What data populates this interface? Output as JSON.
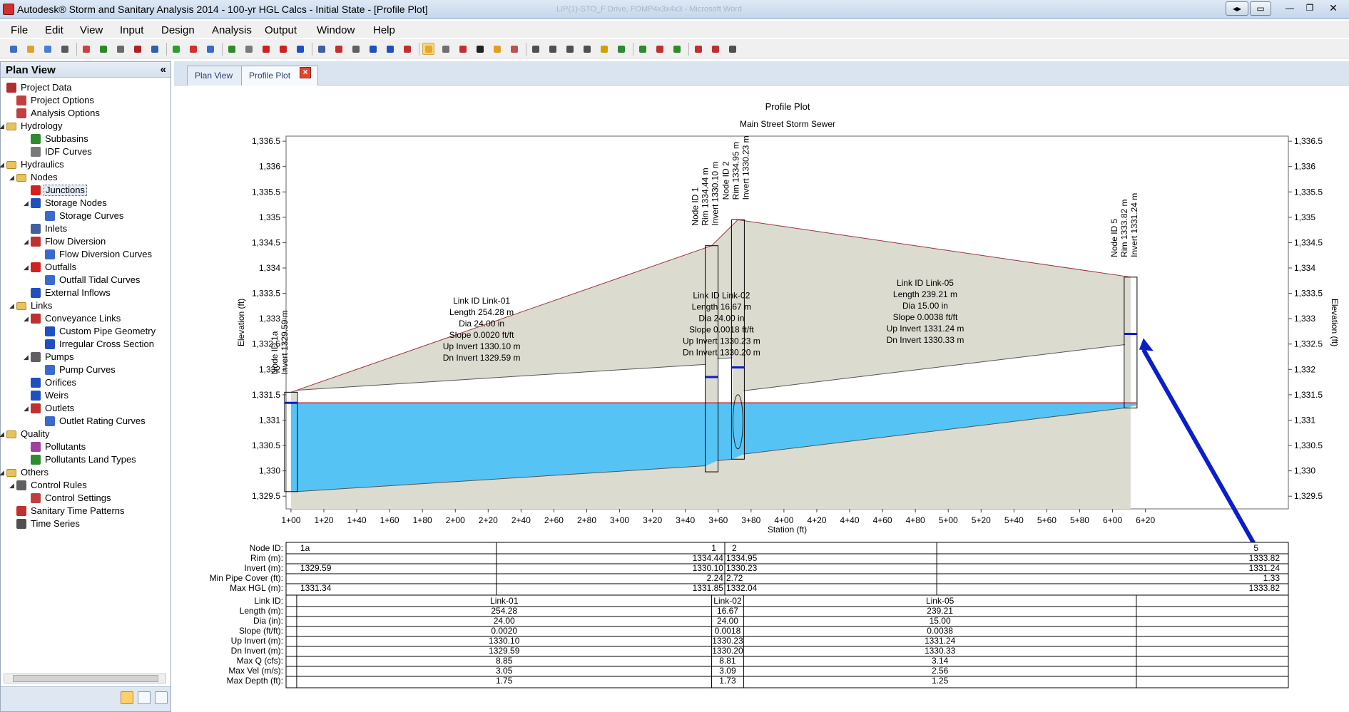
{
  "window": {
    "title": "Autodesk® Storm and Sanitary Analysis 2014 - 100-yr HGL Calcs - Initial State - [Profile Plot]",
    "background_title": "LIP(1)-STO_F Drive, FOMP4x3x4x3 - Microsoft Word"
  },
  "menu": [
    "File",
    "Edit",
    "View",
    "Input",
    "Design",
    "Analysis",
    "Output",
    "Window",
    "Help"
  ],
  "toolbar_icons": [
    "new-icon",
    "open-icon",
    "save-icon",
    "print-icon",
    "calculator-icon",
    "pan-icon",
    "copy-icon",
    "delete-icon",
    "find-icon",
    "add-node-icon",
    "run-icon",
    "help-icon",
    "subbasin-icon",
    "idf-icon",
    "junction-icon",
    "outfall-icon",
    "storage-icon",
    "inlet-icon",
    "pipe-icon",
    "pump-icon",
    "orifice-icon",
    "weir-icon",
    "outlet-icon",
    "select-icon",
    "tools-icon",
    "polygon-icon",
    "text-icon",
    "pencil-icon",
    "measure-icon",
    "zoom-icon",
    "zoom-out-icon",
    "zoom-window-icon",
    "pan-hand-icon",
    "lock-icon",
    "play-icon",
    "step-icon",
    "report-icon",
    "excel-icon",
    "pdf-icon",
    "profile-icon",
    "options-icon"
  ],
  "sidebar": {
    "title": "Plan View",
    "collapse": "«",
    "items": [
      {
        "label": "Project Data",
        "level": 0,
        "toggle": "",
        "icon": "project-data-icon",
        "color": "#b03030"
      },
      {
        "label": "Project Options",
        "level": 1,
        "toggle": "",
        "icon": "checklist-icon",
        "color": "#c04040"
      },
      {
        "label": "Analysis Options",
        "level": 1,
        "toggle": "",
        "icon": "tools-icon",
        "color": "#c04040"
      },
      {
        "label": "Hydrology",
        "level": 0,
        "toggle": "◢",
        "icon": "folder-icon",
        "color": "#e8c35a"
      },
      {
        "label": "Subbasins",
        "level": 2,
        "toggle": "",
        "icon": "subbasin-icon",
        "color": "#2e8b2e"
      },
      {
        "label": "IDF Curves",
        "level": 2,
        "toggle": "",
        "icon": "idf-curve-icon",
        "color": "#7a7a7a"
      },
      {
        "label": "Hydraulics",
        "level": 0,
        "toggle": "◢",
        "icon": "folder-icon",
        "color": "#e8c35a"
      },
      {
        "label": "Nodes",
        "level": 1,
        "toggle": "◢",
        "icon": "folder-icon",
        "color": "#e8c35a"
      },
      {
        "label": "Junctions",
        "level": 2,
        "toggle": "",
        "icon": "junction-icon",
        "color": "#d22020",
        "selected": true
      },
      {
        "label": "Storage Nodes",
        "level": 2,
        "toggle": "◢",
        "icon": "storage-icon",
        "color": "#2050c0"
      },
      {
        "label": "Storage Curves",
        "level": 3,
        "toggle": "",
        "icon": "curve-icon",
        "color": "#3a6ad0"
      },
      {
        "label": "Inlets",
        "level": 2,
        "toggle": "",
        "icon": "inlet-icon",
        "color": "#4060a0"
      },
      {
        "label": "Flow Diversion",
        "level": 2,
        "toggle": "◢",
        "icon": "flow-diversion-icon",
        "color": "#c03030"
      },
      {
        "label": "Flow Diversion Curves",
        "level": 3,
        "toggle": "",
        "icon": "curve-icon",
        "color": "#3a6ad0"
      },
      {
        "label": "Outfalls",
        "level": 2,
        "toggle": "◢",
        "icon": "outfall-icon",
        "color": "#d02020"
      },
      {
        "label": "Outfall Tidal Curves",
        "level": 3,
        "toggle": "",
        "icon": "curve-icon",
        "color": "#3a6ad0"
      },
      {
        "label": "External Inflows",
        "level": 2,
        "toggle": "",
        "icon": "inflow-icon",
        "color": "#2050c0"
      },
      {
        "label": "Links",
        "level": 1,
        "toggle": "◢",
        "icon": "folder-icon",
        "color": "#e8c35a"
      },
      {
        "label": "Conveyance Links",
        "level": 2,
        "toggle": "◢",
        "icon": "conveyance-link-icon",
        "color": "#c03030"
      },
      {
        "label": "Custom Pipe Geometry",
        "level": 3,
        "toggle": "",
        "icon": "pipe-geometry-icon",
        "color": "#2050c0"
      },
      {
        "label": "Irregular Cross Section",
        "level": 3,
        "toggle": "",
        "icon": "cross-section-icon",
        "color": "#2050c0"
      },
      {
        "label": "Pumps",
        "level": 2,
        "toggle": "◢",
        "icon": "pump-icon",
        "color": "#606060"
      },
      {
        "label": "Pump Curves",
        "level": 3,
        "toggle": "",
        "icon": "curve-icon",
        "color": "#3a6ad0"
      },
      {
        "label": "Orifices",
        "level": 2,
        "toggle": "",
        "icon": "orifice-icon",
        "color": "#2050c0"
      },
      {
        "label": "Weirs",
        "level": 2,
        "toggle": "",
        "icon": "weir-icon",
        "color": "#2050c0"
      },
      {
        "label": "Outlets",
        "level": 2,
        "toggle": "◢",
        "icon": "outlet-icon",
        "color": "#c03030"
      },
      {
        "label": "Outlet Rating Curves",
        "level": 3,
        "toggle": "",
        "icon": "curve-icon",
        "color": "#3a6ad0"
      },
      {
        "label": "Quality",
        "level": 0,
        "toggle": "◢",
        "icon": "folder-icon",
        "color": "#e8c35a"
      },
      {
        "label": "Pollutants",
        "level": 2,
        "toggle": "",
        "icon": "pollutant-icon",
        "color": "#a040a0"
      },
      {
        "label": "Pollutants Land Types",
        "level": 2,
        "toggle": "",
        "icon": "land-type-icon",
        "color": "#2e8b2e"
      },
      {
        "label": "Others",
        "level": 0,
        "toggle": "◢",
        "icon": "folder-icon",
        "color": "#e8c35a"
      },
      {
        "label": "Control Rules",
        "level": 1,
        "toggle": "◢",
        "icon": "control-rules-icon",
        "color": "#606060"
      },
      {
        "label": "Control Settings",
        "level": 2,
        "toggle": "",
        "icon": "control-settings-icon",
        "color": "#c04040"
      },
      {
        "label": "Sanitary Time Patterns",
        "level": 1,
        "toggle": "",
        "icon": "time-pattern-icon",
        "color": "#c03030"
      },
      {
        "label": "Time Series",
        "level": 1,
        "toggle": "",
        "icon": "clock-icon",
        "color": "#505050"
      }
    ]
  },
  "tabs": [
    {
      "label": "Plan View",
      "active": false
    },
    {
      "label": "Profile Plot",
      "active": true
    }
  ],
  "chart_data": {
    "type": "profile",
    "title": "Profile Plot",
    "subtitle": "Main Street Storm Sewer",
    "xlabel": "Station (ft)",
    "ylabel": "Elevation (ft)",
    "ylabel_right": "Elevation (ft)",
    "xlim": [
      -3,
      607
    ],
    "ylim": [
      1329.25,
      1336.6
    ],
    "x_ticks": [
      0,
      20,
      40,
      60,
      80,
      100,
      120,
      140,
      160,
      180,
      200,
      220,
      240,
      260,
      280,
      300,
      320,
      340,
      360,
      380,
      400,
      420,
      440,
      460,
      480,
      500,
      520,
      540,
      560,
      580,
      600
    ],
    "x_tick_labels": [
      "1+00",
      "1+20",
      "1+40",
      "1+60",
      "1+80",
      "2+00",
      "2+20",
      "2+40",
      "2+60",
      "2+80",
      "3+00",
      "3+20",
      "3+40",
      "3+60",
      "3+80",
      "4+00",
      "4+20",
      "4+40",
      "4+60",
      "4+80",
      "5+00",
      "5+20",
      "5+40",
      "5+60",
      "5+80",
      "6+00",
      "6+20"
    ],
    "y_ticks": [
      1329.5,
      1330,
      1330.5,
      1331,
      1331.5,
      1332,
      1332.5,
      1333,
      1333.5,
      1334,
      1334.5,
      1335,
      1335.5,
      1336,
      1336.5
    ],
    "y_tick_labels": [
      "1,329.5",
      "1,330",
      "1,330.5",
      "1,331",
      "1,331.5",
      "1,332",
      "1,332.5",
      "1,333",
      "1,333.5",
      "1,334",
      "1,334.5",
      "1,335",
      "1,335.5",
      "1,336",
      "1,336.5"
    ],
    "hgl_elevation": 1331.34,
    "nodes": [
      {
        "id": "1a",
        "station": 0,
        "rim": 1331.55,
        "invert": 1329.59,
        "bottom": 1329.59,
        "hgl": 1331.34,
        "labels": [
          "Node ID 1a",
          "Invert 1329.59 m"
        ]
      },
      {
        "id": "1",
        "station": 256,
        "rim": 1334.44,
        "invert": 1330.1,
        "bottom": 1329.98,
        "hgl": 1331.85,
        "labels": [
          "Node ID 1",
          "Rim 1334.44 m",
          "Invert 1330.10 m"
        ]
      },
      {
        "id": "2",
        "station": 272,
        "rim": 1334.95,
        "invert": 1330.23,
        "bottom": 1330.23,
        "hgl": 1332.04,
        "labels": [
          "Node ID 2",
          "Rim 1334.95 m",
          "Invert 1330.23 m"
        ]
      },
      {
        "id": "5",
        "station": 511,
        "rim": 1333.82,
        "invert": 1331.24,
        "bottom": 1331.24,
        "hgl": 1332.7,
        "labels": [
          "Node ID 5",
          "Rim 1333.82 m",
          "Invert 1331.24 m"
        ]
      }
    ],
    "links": [
      {
        "id": "Link-01",
        "from": "1a",
        "to": "1",
        "up_crown": 1332.1,
        "dn_crown": 1331.59,
        "up_invert": 1330.1,
        "dn_invert": 1329.59,
        "labels": [
          "Link ID Link-01",
          "Length 254.28 m",
          "Dia 24.00 in",
          "Slope 0.0020 ft/ft",
          "Up Invert 1330.10 m",
          "Dn Invert 1329.59 m"
        ],
        "label_station": 116,
        "label_elevation": 1333.3
      },
      {
        "id": "Link-02",
        "from": "1",
        "to": "2",
        "up_crown": 1332.23,
        "dn_crown": 1332.21,
        "up_invert": 1330.23,
        "dn_invert": 1330.2,
        "labels": [
          "Link ID Link-02",
          "Length 16.67 m",
          "Dia 24.00 in",
          "Slope 0.0018 ft/ft",
          "Up Invert 1330.23 m",
          "Dn Invert 1330.20 m"
        ],
        "label_station": 262,
        "label_elevation": 1333.4
      },
      {
        "id": "Link-05",
        "from": "2",
        "to": "5",
        "up_crown": 1332.49,
        "dn_crown": 1331.58,
        "up_invert": 1331.24,
        "dn_invert": 1330.33,
        "labels": [
          "Link ID Link-05",
          "Length 239.21 m",
          "Dia 15.00 in",
          "Slope 0.0038 ft/ft",
          "Up Invert 1331.24 m",
          "Dn Invert 1330.33 m"
        ],
        "label_station": 386,
        "label_elevation": 1333.65
      }
    ],
    "node_table": {
      "headers": [
        "Node ID:",
        "Rim (m):",
        "Invert (m):",
        "Min Pipe Cover (ft):",
        "Max HGL (m):"
      ],
      "columns": [
        {
          "node": "1a",
          "values": [
            "1a",
            "",
            "1329.59",
            "",
            "1331.34"
          ],
          "align": "left"
        },
        {
          "node": "1",
          "values": [
            "1",
            "1334.44",
            "1330.10",
            "2.24",
            "1331.85"
          ],
          "align": "right"
        },
        {
          "node": "2",
          "values": [
            "2",
            "1334.95",
            "1330.23",
            "2.72",
            "1332.04"
          ],
          "align": "left"
        },
        {
          "node": "5",
          "values": [
            "5",
            "1333.82",
            "1331.24",
            "1.33",
            "1333.82"
          ],
          "align": "right"
        }
      ]
    },
    "link_table": {
      "headers": [
        "Link ID:",
        "Length (m):",
        "Dia (in):",
        "Slope (ft/ft):",
        "Up Invert (m):",
        "Dn Invert (m):",
        "Max Q (cfs):",
        "Max Vel (m/s):",
        "Max Depth (ft):"
      ],
      "columns": [
        {
          "link": "Link-01",
          "values": [
            "Link-01",
            "254.28",
            "24.00",
            "0.0020",
            "1330.10",
            "1329.59",
            "8.85",
            "3.05",
            "1.75"
          ]
        },
        {
          "link": "Link-02",
          "values": [
            "Link-02",
            "16.67",
            "24.00",
            "0.0018",
            "1330.23",
            "1330.20",
            "8.81",
            "3.09",
            "1.73"
          ]
        },
        {
          "link": "Link-05",
          "values": [
            "Link-05",
            "239.21",
            "15.00",
            "0.0038",
            "1331.24",
            "1330.33",
            "3.14",
            "2.56",
            "1.25"
          ]
        }
      ]
    },
    "colors": {
      "ground_fill": "#dcdbd0",
      "water_fill": "#55c4f5",
      "hgl_line": "#c0303a",
      "ground_line": "#9b3344",
      "hgl_marker": "#0b1ec8",
      "annotation_arrow": "#0b1ec8",
      "pipe_outline": "#000000"
    }
  }
}
